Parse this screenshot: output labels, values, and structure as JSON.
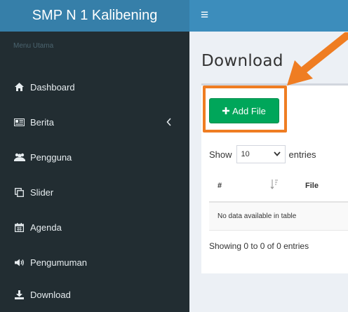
{
  "header": {
    "brand": "SMP N 1 Kalibening",
    "menu_icon": "hamburger-icon"
  },
  "sidebar": {
    "header": "Menu Utama",
    "items": [
      {
        "label": "Dashboard",
        "icon": "home-icon"
      },
      {
        "label": "Berita",
        "icon": "newspaper-icon",
        "has_chevron": true
      },
      {
        "label": "Pengguna",
        "icon": "users-icon"
      },
      {
        "label": "Slider",
        "icon": "slider-icon"
      },
      {
        "label": "Agenda",
        "icon": "calendar-icon"
      },
      {
        "label": "Pengumuman",
        "icon": "megaphone-icon"
      },
      {
        "label": "Download",
        "icon": "download-icon"
      }
    ]
  },
  "main": {
    "title": "Download",
    "add_button": "Add File",
    "show_label": "Show",
    "entries_value": "10",
    "entries_label": "entries",
    "columns": [
      "#",
      "File"
    ],
    "empty_text": "No data available in table",
    "info": "Showing 0 to 0 of 0 entries"
  },
  "colors": {
    "brand": "#367fa9",
    "topbar": "#3c8dbc",
    "sidebar": "#222d32",
    "success": "#00a65a",
    "annotation": "#ef7d22"
  }
}
